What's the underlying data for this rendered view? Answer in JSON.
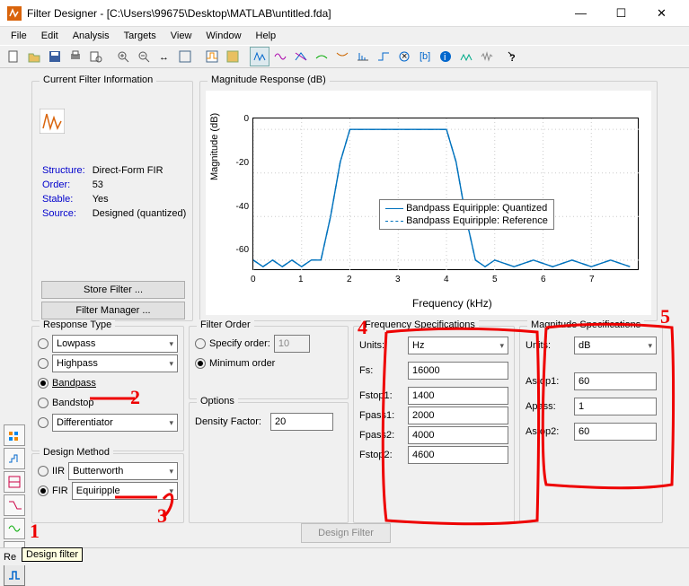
{
  "window": {
    "title": "Filter Designer -  [C:\\Users\\99675\\Desktop\\MATLAB\\untitled.fda]",
    "min": "—",
    "max": "☐",
    "close": "✕"
  },
  "menus": [
    "File",
    "Edit",
    "Analysis",
    "Targets",
    "View",
    "Window",
    "Help"
  ],
  "cfi": {
    "legend": "Current Filter Information",
    "structure_lbl": "Structure:",
    "structure_val": "Direct-Form FIR",
    "order_lbl": "Order:",
    "order_val": "53",
    "stable_lbl": "Stable:",
    "stable_val": "Yes",
    "source_lbl": "Source:",
    "source_val": "Designed (quantized)",
    "store_btn": "Store Filter ...",
    "manager_btn": "Filter Manager ..."
  },
  "mag": {
    "legend": "Magnitude Response (dB)",
    "ylabel": "Magnitude (dB)",
    "xlabel": "Frequency (kHz)",
    "legend1": "Bandpass Equiripple: Quantized",
    "legend2": "Bandpass Equiripple: Reference"
  },
  "chart_data": {
    "type": "line",
    "title": "Magnitude Response (dB)",
    "xlabel": "Frequency (kHz)",
    "ylabel": "Magnitude (dB)",
    "xlim": [
      0,
      8
    ],
    "ylim": [
      -65,
      5
    ],
    "xticks": [
      0,
      1,
      2,
      3,
      4,
      5,
      6,
      7
    ],
    "yticks": [
      0,
      -20,
      -40,
      -60
    ],
    "series": [
      {
        "name": "Bandpass Equiripple: Quantized",
        "style": "solid",
        "x": [
          0,
          0.2,
          0.4,
          0.6,
          0.8,
          1.0,
          1.2,
          1.4,
          1.6,
          1.8,
          2.0,
          2.2,
          2.5,
          3.0,
          3.5,
          3.8,
          4.0,
          4.2,
          4.4,
          4.6,
          4.8,
          5.0,
          5.4,
          5.8,
          6.2,
          6.6,
          7.0,
          7.4,
          7.8
        ],
        "y": [
          -60,
          -63,
          -60,
          -63,
          -60,
          -63,
          -60,
          -60,
          -40,
          -15,
          0,
          0,
          0,
          0,
          0,
          0,
          0,
          -15,
          -40,
          -60,
          -63,
          -60,
          -63,
          -60,
          -63,
          -60,
          -63,
          -60,
          -63
        ]
      },
      {
        "name": "Bandpass Equiripple: Reference",
        "style": "dashdot",
        "x": [
          0,
          0.2,
          0.4,
          0.6,
          0.8,
          1.0,
          1.2,
          1.4,
          1.6,
          1.8,
          2.0,
          2.2,
          2.5,
          3.0,
          3.5,
          3.8,
          4.0,
          4.2,
          4.4,
          4.6,
          4.8,
          5.0,
          5.4,
          5.8,
          6.2,
          6.6,
          7.0,
          7.4,
          7.8
        ],
        "y": [
          -60,
          -63,
          -60,
          -63,
          -60,
          -63,
          -60,
          -60,
          -40,
          -15,
          0,
          0,
          0,
          0,
          0,
          0,
          0,
          -15,
          -40,
          -60,
          -63,
          -60,
          -63,
          -60,
          -63,
          -60,
          -63,
          -60,
          -63
        ]
      }
    ]
  },
  "response_type": {
    "legend": "Response Type",
    "lowpass": "Lowpass",
    "highpass": "Highpass",
    "bandpass": "Bandpass",
    "bandstop": "Bandstop",
    "differentiator": "Differentiator"
  },
  "design_method": {
    "legend": "Design Method",
    "iir_lbl": "IIR",
    "iir_val": "Butterworth",
    "fir_lbl": "FIR",
    "fir_val": "Equiripple"
  },
  "filter_order": {
    "legend": "Filter Order",
    "specify": "Specify order:",
    "specify_val": "10",
    "minimum": "Minimum order"
  },
  "options": {
    "legend": "Options",
    "density_lbl": "Density Factor:",
    "density_val": "20"
  },
  "freq_spec": {
    "legend": "Frequency Specifications",
    "units_lbl": "Units:",
    "units_val": "Hz",
    "fs_lbl": "Fs:",
    "fs_val": "16000",
    "fstop1_lbl": "Fstop1:",
    "fstop1_val": "1400",
    "fpass1_lbl": "Fpass1:",
    "fpass1_val": "2000",
    "fpass2_lbl": "Fpass2:",
    "fpass2_val": "4000",
    "fstop2_lbl": "Fstop2:",
    "fstop2_val": "4600"
  },
  "mag_spec": {
    "legend": "Magnitude Specifications",
    "units_lbl": "Units:",
    "units_val": "dB",
    "astop1_lbl": "Astop1:",
    "astop1_val": "60",
    "apass_lbl": "Apass:",
    "apass_val": "1",
    "astop2_lbl": "Astop2:",
    "astop2_val": "60"
  },
  "design_btn": "Design Filter",
  "status": "Re",
  "tooltip": "Design filter",
  "annotations": {
    "n1": "1",
    "n2": "2",
    "n3": "3",
    "n4": "4",
    "n5": "5"
  }
}
